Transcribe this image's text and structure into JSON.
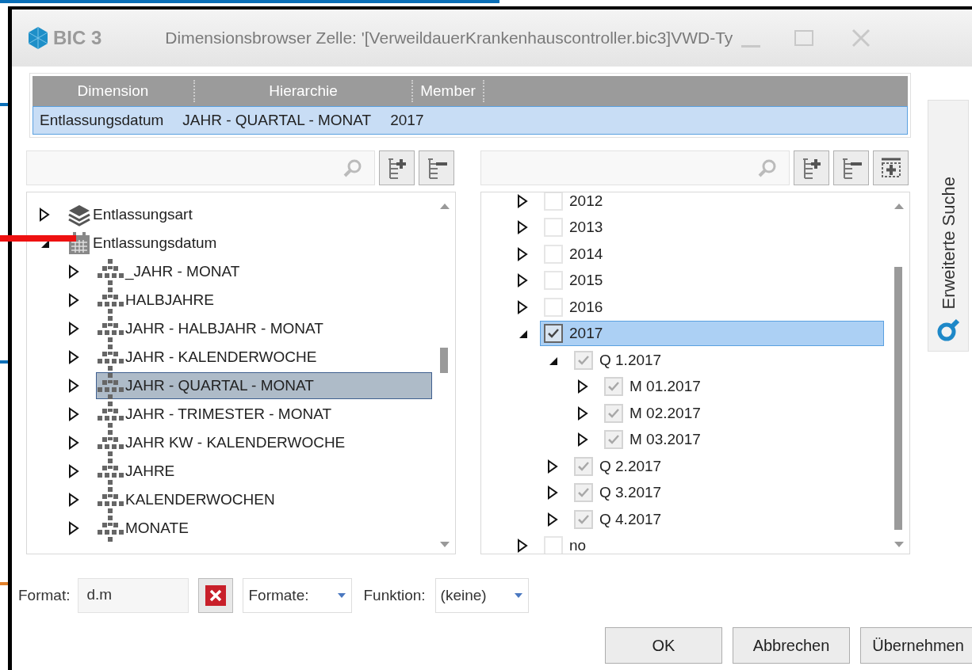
{
  "window": {
    "app_name": "BIC 3",
    "title": "Dimensionsbrowser Zelle: '[VerweildauerKrankenhauscontroller.bic3]VWD-Ty"
  },
  "selection_table": {
    "columns": [
      "Dimension",
      "Hierarchie",
      "Member"
    ],
    "rows": [
      {
        "cells": [
          "Entlassungsdatum",
          "JAHR - QUARTAL - MONAT",
          "2017"
        ],
        "selected": true
      }
    ]
  },
  "left_tree": {
    "items": [
      {
        "label": "Entlassungsart",
        "kind": "dimension",
        "expanded": false,
        "selected": false
      },
      {
        "label": "Entlassungsdatum",
        "kind": "date-dimension",
        "expanded": true,
        "selected": false,
        "children": [
          {
            "label": "_JAHR - MONAT",
            "kind": "hierarchy",
            "expanded": false,
            "selected": false
          },
          {
            "label": "HALBJAHRE",
            "kind": "hierarchy",
            "expanded": false,
            "selected": false
          },
          {
            "label": "JAHR - HALBJAHR - MONAT",
            "kind": "hierarchy",
            "expanded": false,
            "selected": false
          },
          {
            "label": "JAHR - KALENDERWOCHE",
            "kind": "hierarchy",
            "expanded": false,
            "selected": false
          },
          {
            "label": "JAHR - QUARTAL - MONAT",
            "kind": "hierarchy",
            "expanded": false,
            "selected": true
          },
          {
            "label": "JAHR - TRIMESTER - MONAT",
            "kind": "hierarchy",
            "expanded": false,
            "selected": false
          },
          {
            "label": "JAHR KW - KALENDERWOCHE",
            "kind": "hierarchy",
            "expanded": false,
            "selected": false
          },
          {
            "label": "JAHRE",
            "kind": "hierarchy",
            "expanded": false,
            "selected": false
          },
          {
            "label": "KALENDERWOCHEN",
            "kind": "hierarchy",
            "expanded": false,
            "selected": false
          },
          {
            "label": "MONATE",
            "kind": "hierarchy",
            "expanded": false,
            "selected": false
          }
        ]
      }
    ]
  },
  "right_tree": {
    "items": [
      {
        "label": "2012",
        "expanded": false,
        "checked": false,
        "selected": false
      },
      {
        "label": "2013",
        "expanded": false,
        "checked": false,
        "selected": false
      },
      {
        "label": "2014",
        "expanded": false,
        "checked": false,
        "selected": false
      },
      {
        "label": "2015",
        "expanded": false,
        "checked": false,
        "selected": false
      },
      {
        "label": "2016",
        "expanded": false,
        "checked": false,
        "selected": false
      },
      {
        "label": "2017",
        "expanded": true,
        "checked": true,
        "dimmed": false,
        "selected": true,
        "children": [
          {
            "label": "Q 1.2017",
            "expanded": true,
            "checked": true,
            "dimmed": true,
            "selected": false,
            "children": [
              {
                "label": "M 01.2017",
                "expanded": false,
                "checked": true,
                "dimmed": true,
                "selected": false
              },
              {
                "label": "M 02.2017",
                "expanded": false,
                "checked": true,
                "dimmed": true,
                "selected": false
              },
              {
                "label": "M 03.2017",
                "expanded": false,
                "checked": true,
                "dimmed": true,
                "selected": false
              }
            ]
          },
          {
            "label": "Q 2.2017",
            "expanded": false,
            "checked": true,
            "dimmed": true,
            "selected": false
          },
          {
            "label": "Q 3.2017",
            "expanded": false,
            "checked": true,
            "dimmed": true,
            "selected": false
          },
          {
            "label": "Q 4.2017",
            "expanded": false,
            "checked": true,
            "dimmed": true,
            "selected": false
          }
        ]
      },
      {
        "label": "no",
        "expanded": false,
        "checked": false,
        "selected": false
      }
    ]
  },
  "side_tab": {
    "label": "Erweiterte Suche"
  },
  "format_bar": {
    "format_label": "Format:",
    "format_value": "d.m",
    "formats_dropdown": "Formate:",
    "function_label": "Funktion:",
    "function_dropdown": "(keine)"
  },
  "buttons": [
    "OK",
    "Abbrechen",
    "Übernehmen"
  ]
}
